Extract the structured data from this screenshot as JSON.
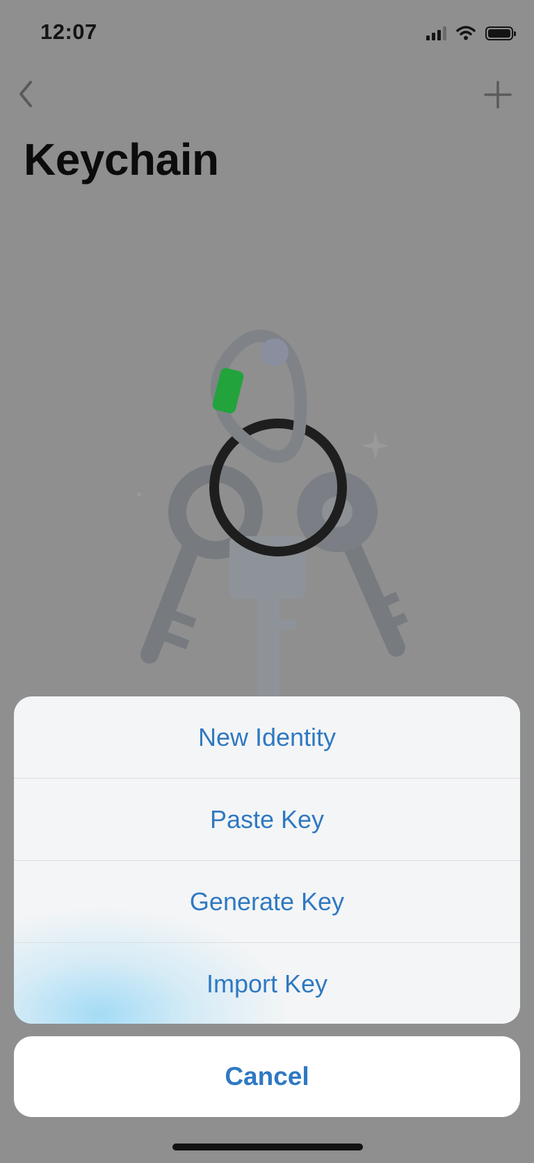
{
  "status_bar": {
    "time": "12:07",
    "icons": [
      "cellular-signal-icon",
      "wifi-icon",
      "battery-icon"
    ]
  },
  "nav": {
    "back_icon": "chevron-left-icon",
    "add_icon": "plus-icon"
  },
  "page": {
    "title": "Keychain"
  },
  "illustration": {
    "name": "keychain-illustration",
    "accent_color": "#22a33b",
    "ring_color": "#1e1e1e"
  },
  "action_sheet": {
    "actions": [
      {
        "label": "New Identity"
      },
      {
        "label": "Paste Key"
      },
      {
        "label": "Generate Key"
      },
      {
        "label": "Import Key"
      }
    ],
    "cancel_label": "Cancel"
  },
  "colors": {
    "action_text": "#2f79c2",
    "dimmed_background": "#8f8f8f",
    "sheet_background": "#f4f5f6"
  }
}
